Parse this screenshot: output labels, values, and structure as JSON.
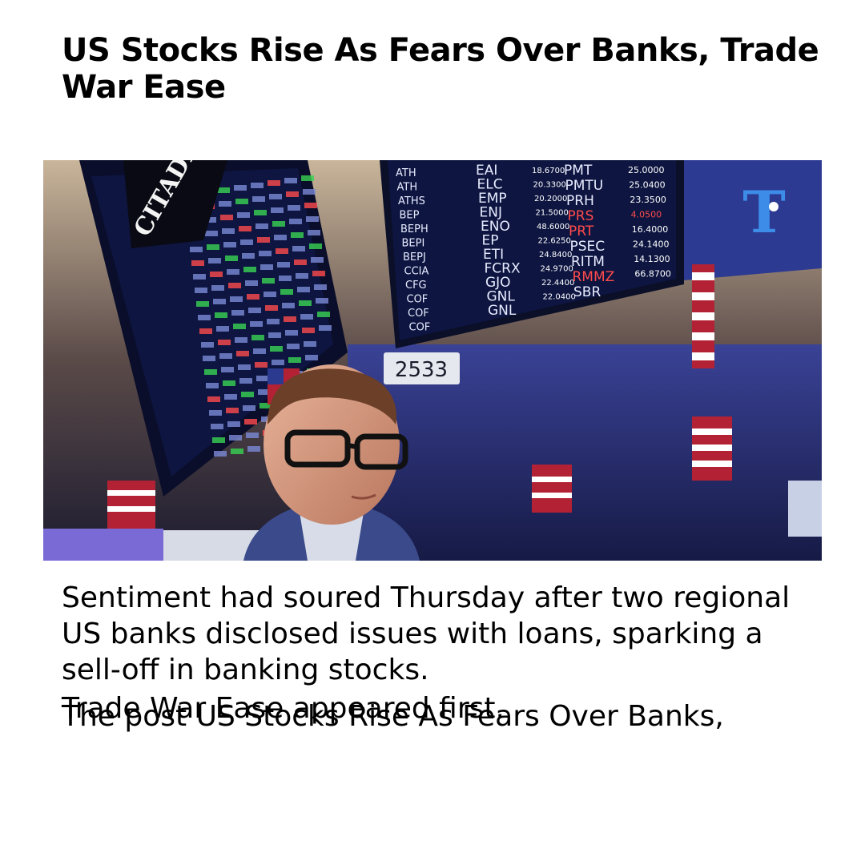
{
  "article": {
    "headline": "US Stocks Rise As Fears Over Banks, Trade War Ease",
    "summary": "Sentiment had soured Thursday after two regional US banks disclosed issues with loans, sparking a sell-off in banking stocks.",
    "footer_line_1": "Trade War Ease appeared first.",
    "footer_line_2": "The post US Stocks Rise As Fears Over Banks,"
  },
  "photo": {
    "board_sign": "CITADEL",
    "post_number": "2533",
    "logo_letter": "T",
    "ticker_left": [
      "ATH",
      "ATH",
      "ATHS",
      "BEP",
      "BEPH",
      "BEPI",
      "BEPJ",
      "CCIA",
      "CFG",
      "COF",
      "COF",
      "COF"
    ],
    "ticker_mid": [
      "EAI",
      "ELC",
      "EMP",
      "ENJ",
      "ENO",
      "EP",
      "ETI",
      "FCRX",
      "GJO",
      "GNL",
      "GNL"
    ],
    "price_mid": [
      "18.6700",
      "20.3300",
      "20.2000",
      "21.5000",
      "48.6000",
      "22.6250",
      "24.8400",
      "24.9700",
      "22.4400",
      "22.0400",
      ""
    ],
    "ticker_right": [
      "PMT",
      "PMTU",
      "PRH",
      "PRS",
      "PRT",
      "PSEC",
      "RITM",
      "RMMZ",
      "SBR"
    ],
    "price_right": [
      "25.0000",
      "25.0400",
      "23.3500",
      "4.0500",
      "16.4000",
      "24.1400",
      "14.1300",
      "66.8700",
      ""
    ],
    "colors": {
      "screen_bg": "#0d1540",
      "ticker_text": "#e8ecff",
      "up_green": "#39d353",
      "down_red": "#ff4b4b",
      "ceiling_blue": "#2a3375"
    }
  }
}
